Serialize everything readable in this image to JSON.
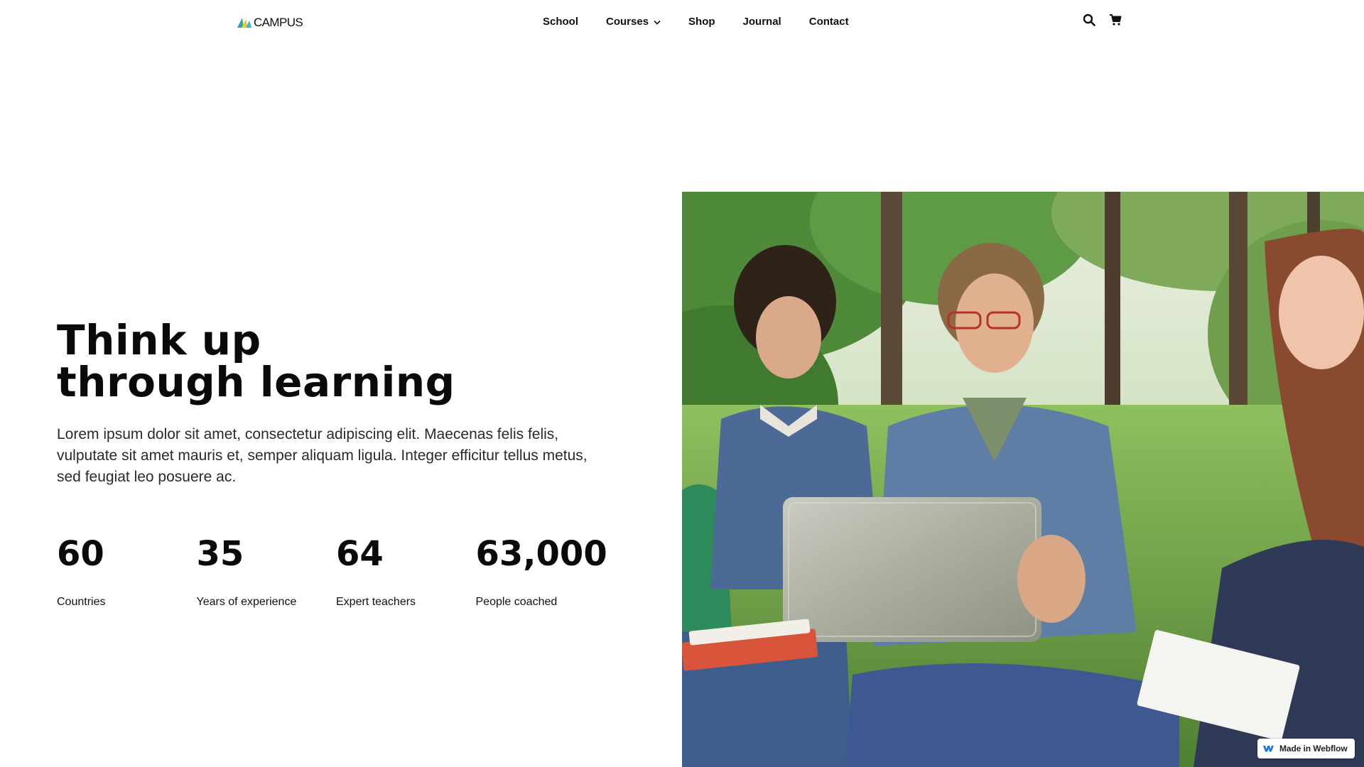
{
  "brand": {
    "name": "CAMPUS"
  },
  "nav": {
    "items": [
      {
        "label": "School",
        "dropdown": false
      },
      {
        "label": "Courses",
        "dropdown": true
      },
      {
        "label": "Shop",
        "dropdown": false
      },
      {
        "label": "Journal",
        "dropdown": false
      },
      {
        "label": "Contact",
        "dropdown": false
      }
    ],
    "icons": [
      "search-icon",
      "cart-icon"
    ]
  },
  "hero": {
    "title_line1": "Think up",
    "title_line2": "through learning",
    "description": "Lorem ipsum dolor sit amet, consectetur adipiscing elit. Maecenas felis felis, vulputate sit amet mauris et, semper aliquam ligula. Integer efficitur tellus metus, sed feugiat leo posuere ac."
  },
  "stats": [
    {
      "value": "60",
      "label": "Countries"
    },
    {
      "value": "35",
      "label": "Years of experience"
    },
    {
      "value": "64",
      "label": "Expert teachers"
    },
    {
      "value": "63,000",
      "label": "People coached"
    }
  ],
  "badge": {
    "label": "Made in Webflow"
  },
  "colors": {
    "text": "#0a0a0a",
    "background": "#ffffff",
    "logo_teal": "#2aa8a0",
    "logo_yellow": "#e9c93b",
    "webflow_blue": "#146ef5"
  }
}
